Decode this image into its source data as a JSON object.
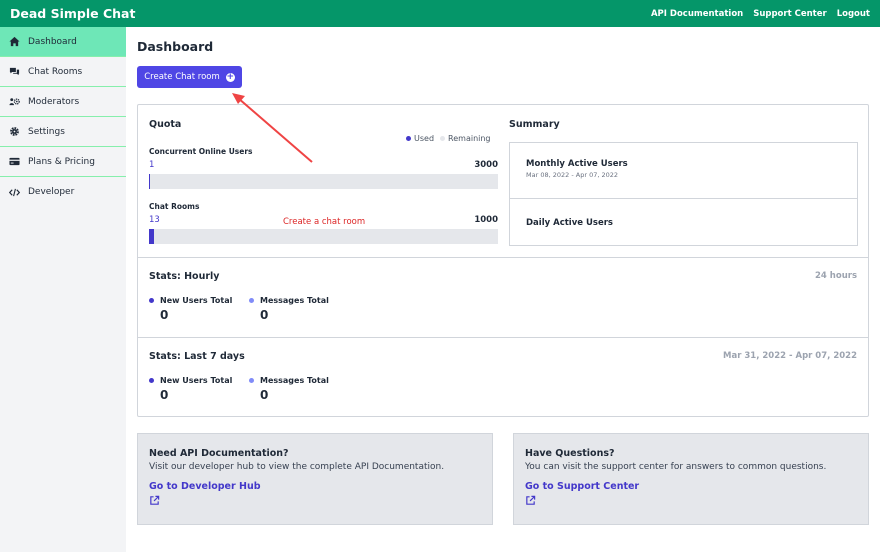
{
  "app": {
    "brand": "Dead Simple Chat"
  },
  "topnav": [
    {
      "label": "API Documentation"
    },
    {
      "label": "Support Center"
    },
    {
      "label": "Logout"
    }
  ],
  "sidebar": {
    "items": [
      {
        "label": "Dashboard",
        "icon": "home-icon",
        "active": true
      },
      {
        "label": "Chat Rooms",
        "icon": "chat-icon"
      },
      {
        "label": "Moderators",
        "icon": "users-cog-icon"
      },
      {
        "label": "Settings",
        "icon": "gear-icon"
      },
      {
        "label": "Plans & Pricing",
        "icon": "credit-card-icon"
      },
      {
        "label": "Developer",
        "icon": "code-icon"
      }
    ]
  },
  "main": {
    "title": "Dashboard",
    "create_button": "Create Chat room",
    "quota": {
      "title": "Quota",
      "legend_used": "Used",
      "legend_remaining": "Remaining",
      "concurrent": {
        "label": "Concurrent Online Users",
        "used": "1",
        "total": "3000",
        "fill_pct": 0.03
      },
      "rooms": {
        "label": "Chat Rooms",
        "used": "13",
        "total": "1000",
        "fill_pct": 1.3
      }
    },
    "annotation": "Create a chat room",
    "summary": {
      "title": "Summary",
      "monthly": {
        "title": "Monthly Active Users",
        "range": "Mar 08, 2022 - Apr 07, 2022"
      },
      "daily": {
        "title": "Daily Active Users"
      }
    },
    "hourly": {
      "title": "Stats: Hourly",
      "range": "24 hours",
      "new_users_label": "New Users Total",
      "new_users_value": "0",
      "messages_label": "Messages Total",
      "messages_value": "0"
    },
    "weekly": {
      "title": "Stats: Last 7 days",
      "range": "Mar 31, 2022 - Apr 07, 2022",
      "new_users_label": "New Users Total",
      "new_users_value": "0",
      "messages_label": "Messages Total",
      "messages_value": "0"
    },
    "api_card": {
      "title": "Need API Documentation?",
      "text": "Visit our developer hub to view the complete API Documentation.",
      "link": "Go to Developer Hub"
    },
    "help_card": {
      "title": "Have Questions?",
      "text": "You can visit the support center for answers to common questions.",
      "link": "Go to Support Center"
    }
  },
  "colors": {
    "topbar": "#059669",
    "active_sidebar": "#6ee7b7",
    "primary": "#4f46e5",
    "used": "#4338ca",
    "remaining": "#e5e7eb",
    "annotation": "#dc2626"
  }
}
